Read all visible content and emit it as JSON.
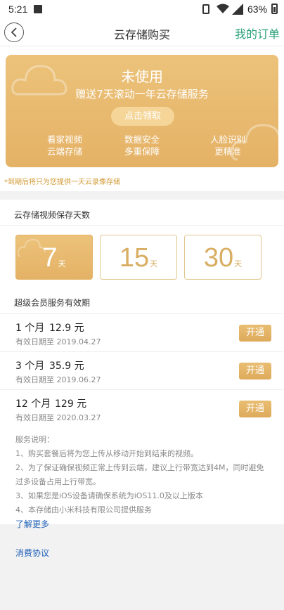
{
  "status_bar": {
    "time": "5:21",
    "battery": "63%"
  },
  "header": {
    "title": "云存储购买",
    "orders": "我的订单"
  },
  "promo": {
    "status": "未使用",
    "subtitle": "赠送7天滚动一年云存储服务",
    "claim_button": "点击领取",
    "features": [
      {
        "line1": "看家视频",
        "line2": "云端存储"
      },
      {
        "line1": "数据安全",
        "line2": "多重保障"
      },
      {
        "line1": "人脸识别",
        "line2": "更精准"
      }
    ]
  },
  "notice": "*到期后将只为您提供一天云录像存储",
  "days_section": {
    "label": "云存储视频保存天数",
    "unit": "天",
    "options": [
      {
        "value": "7",
        "selected": true
      },
      {
        "value": "15",
        "selected": false
      },
      {
        "value": "30",
        "selected": false
      }
    ]
  },
  "plans_section": {
    "label": "超级会员服务有效期",
    "open_label": "开通",
    "plans": [
      {
        "name": "1 个月",
        "price": "12.9 元",
        "expiry": "有效日期至 2019.04.27"
      },
      {
        "name": "3 个月",
        "price": "35.9 元",
        "expiry": "有效日期至 2019.06.27"
      },
      {
        "name": "12 个月",
        "price": "129 元",
        "expiry": "有效日期至 2020.03.27"
      }
    ]
  },
  "notes": {
    "title": "服务说明：",
    "lines": [
      "1、购买套餐后将为您上传从移动开始到结束的视频。",
      "2、为了保证确保视频正常上传到云端，建议上行带宽达到4M，同时避免",
      "过多设备占用上行带宽。",
      "3、如果您是iOS设备请确保系统为iOS11.0及以上版本",
      "4、本存储由小米科技有限公司提供服务"
    ],
    "learn_more": "了解更多",
    "agreement": "消费协议"
  },
  "colors": {
    "gold": "#e4b266",
    "green": "#28a07a",
    "link": "#1f5fb6"
  }
}
